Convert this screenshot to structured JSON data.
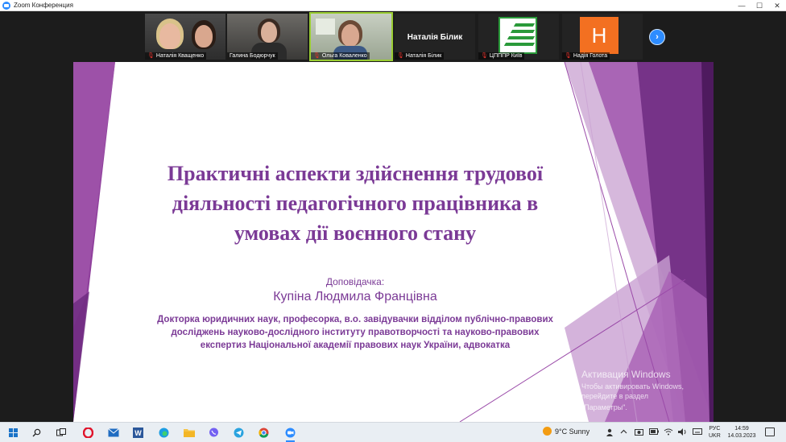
{
  "window": {
    "title": "Zoom Конференция",
    "controls": {
      "minimize": "—",
      "maximize": "☐",
      "close": "✕"
    }
  },
  "participants": [
    {
      "name": "Наталія Кващенко",
      "video": true,
      "muted": true
    },
    {
      "name": "Галина Бодюрчук",
      "video": true,
      "muted": false
    },
    {
      "name": "Ольга Коваленко",
      "video": true,
      "muted": true,
      "active_speaker": true
    },
    {
      "name": "Наталія Білик",
      "display_name": "Наталія Білик",
      "video": false,
      "muted": true
    },
    {
      "name": "ЦПППР Київ",
      "video": false,
      "muted": true,
      "avatar": "logo"
    },
    {
      "name": "Надія Голота",
      "video": false,
      "muted": true,
      "avatar": "Н"
    }
  ],
  "next_page_icon": "chevron-right-icon",
  "slide": {
    "title": "Практичні аспекти здійснення трудової діяльності педагогічного працівника в умовах дії воєнного стану",
    "speaker_label": "Доповідачка:",
    "speaker_name": "Купіна Людмила Францівна",
    "speaker_description": "Докторка юридичних наук, професорка, в.о. завідувачки відділом публічно-правових досліджень науково-дослідного інституту правотворчості та науково-правових експертиз Національної академії правових наук України, адвокатка",
    "accent_color": "#7b3a96"
  },
  "activation_watermark": {
    "line1": "Активация Windows",
    "line2": "Чтобы активировать Windows, перейдите в раздел",
    "line3": "\"Параметры\"."
  },
  "taskbar": {
    "weather_temp": "9°C",
    "weather_text": "Sunny",
    "lang_top": "РУС",
    "lang_bottom": "UKR",
    "time": "14:59",
    "date": "14.03.2023"
  }
}
